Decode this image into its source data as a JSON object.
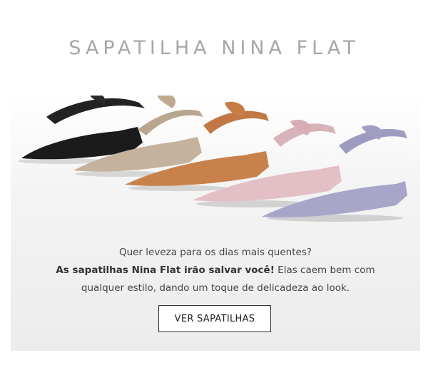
{
  "header": {
    "title": "SAPATILHA NINA FLAT"
  },
  "hero": {
    "image_alt": "Five pointed-toe flats with ankle bows in black, taupe, caramel, pink and lilac suede",
    "shoe_colors": [
      "#1b1b1b",
      "#c4b29c",
      "#c9814c",
      "#e2c0c6",
      "#a7a6c8"
    ]
  },
  "copy": {
    "line1": "Quer leveza para os dias mais quentes?",
    "line2_bold": "As sapatilhas Nina Flat irão salvar você!",
    "line2_rest": " Elas caem bem com",
    "line3": "qualquer estilo, dando um toque de delicadeza ao look."
  },
  "cta": {
    "label": "VER SAPATILHAS"
  }
}
